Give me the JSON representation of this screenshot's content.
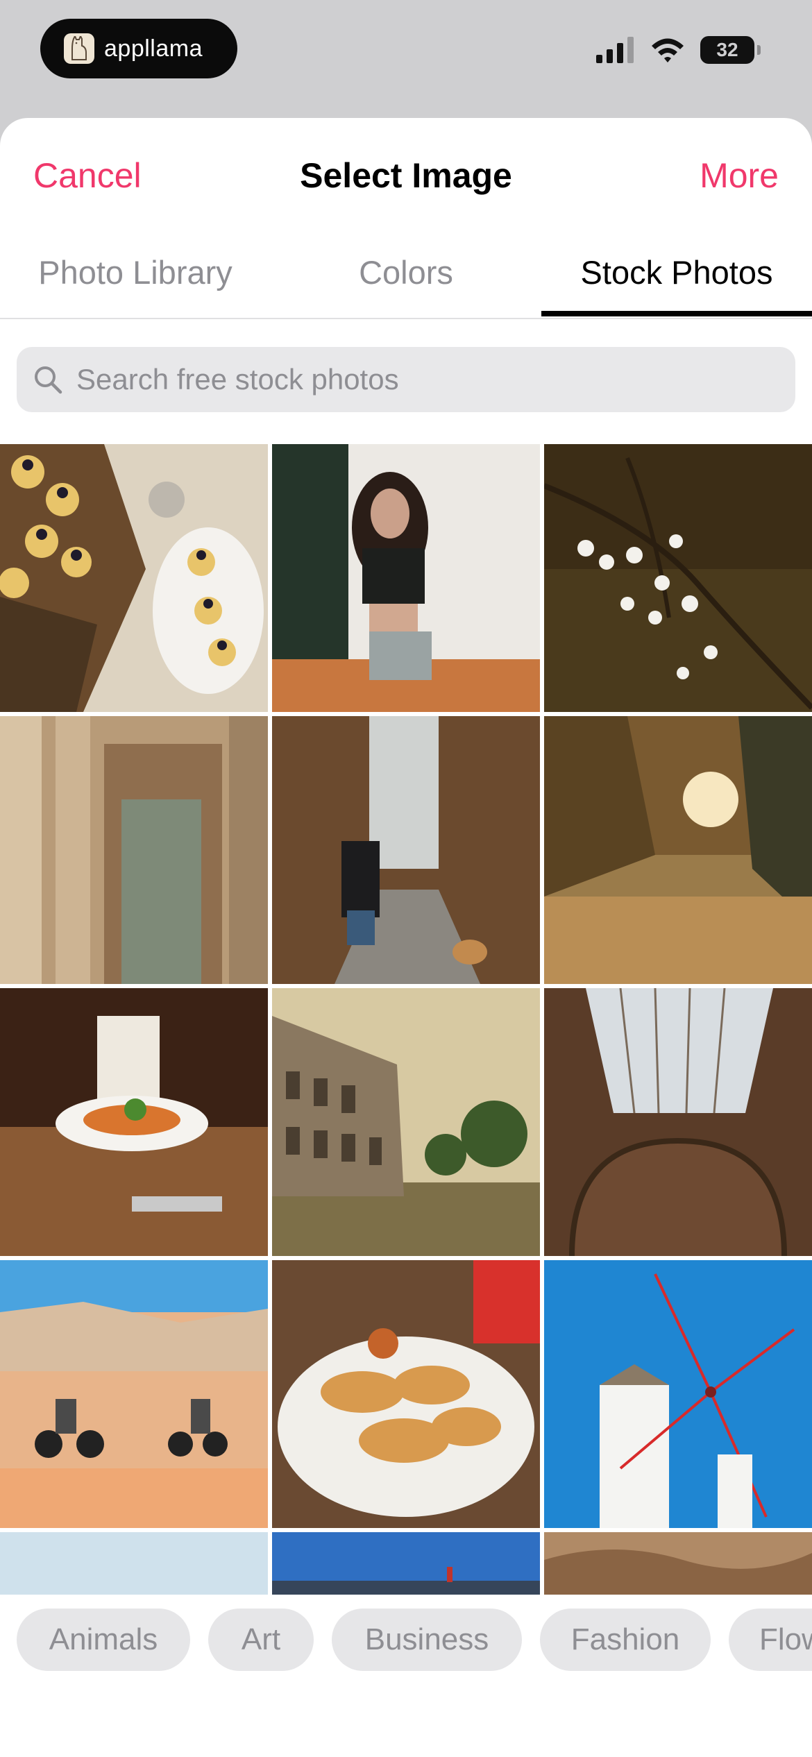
{
  "status": {
    "app_name": "appllama",
    "battery": "32"
  },
  "nav": {
    "cancel": "Cancel",
    "title": "Select Image",
    "more": "More"
  },
  "tabs": [
    {
      "label": "Photo Library",
      "active": false
    },
    {
      "label": "Colors",
      "active": false
    },
    {
      "label": "Stock Photos",
      "active": true
    }
  ],
  "search": {
    "placeholder": "Search free stock photos"
  },
  "photos": [
    "food-pastries-table",
    "woman-portrait-doorway",
    "white-blossom-branch",
    "building-columns-door",
    "person-dog-forest-path",
    "sunset-trees-path",
    "pasta-restaurant-table",
    "colosseum-sunset",
    "arched-glass-ceiling",
    "desert-motorbikes",
    "pancakes-plate",
    "windmill-blue-sky",
    "pale-sky",
    "blue-sky-spire",
    "rocky-terrain"
  ],
  "categories": [
    "Animals",
    "Art",
    "Business",
    "Fashion",
    "Flow"
  ],
  "colors": {
    "accent": "#f0386b",
    "active_tab": "#000000",
    "inactive": "#8e8e93"
  }
}
